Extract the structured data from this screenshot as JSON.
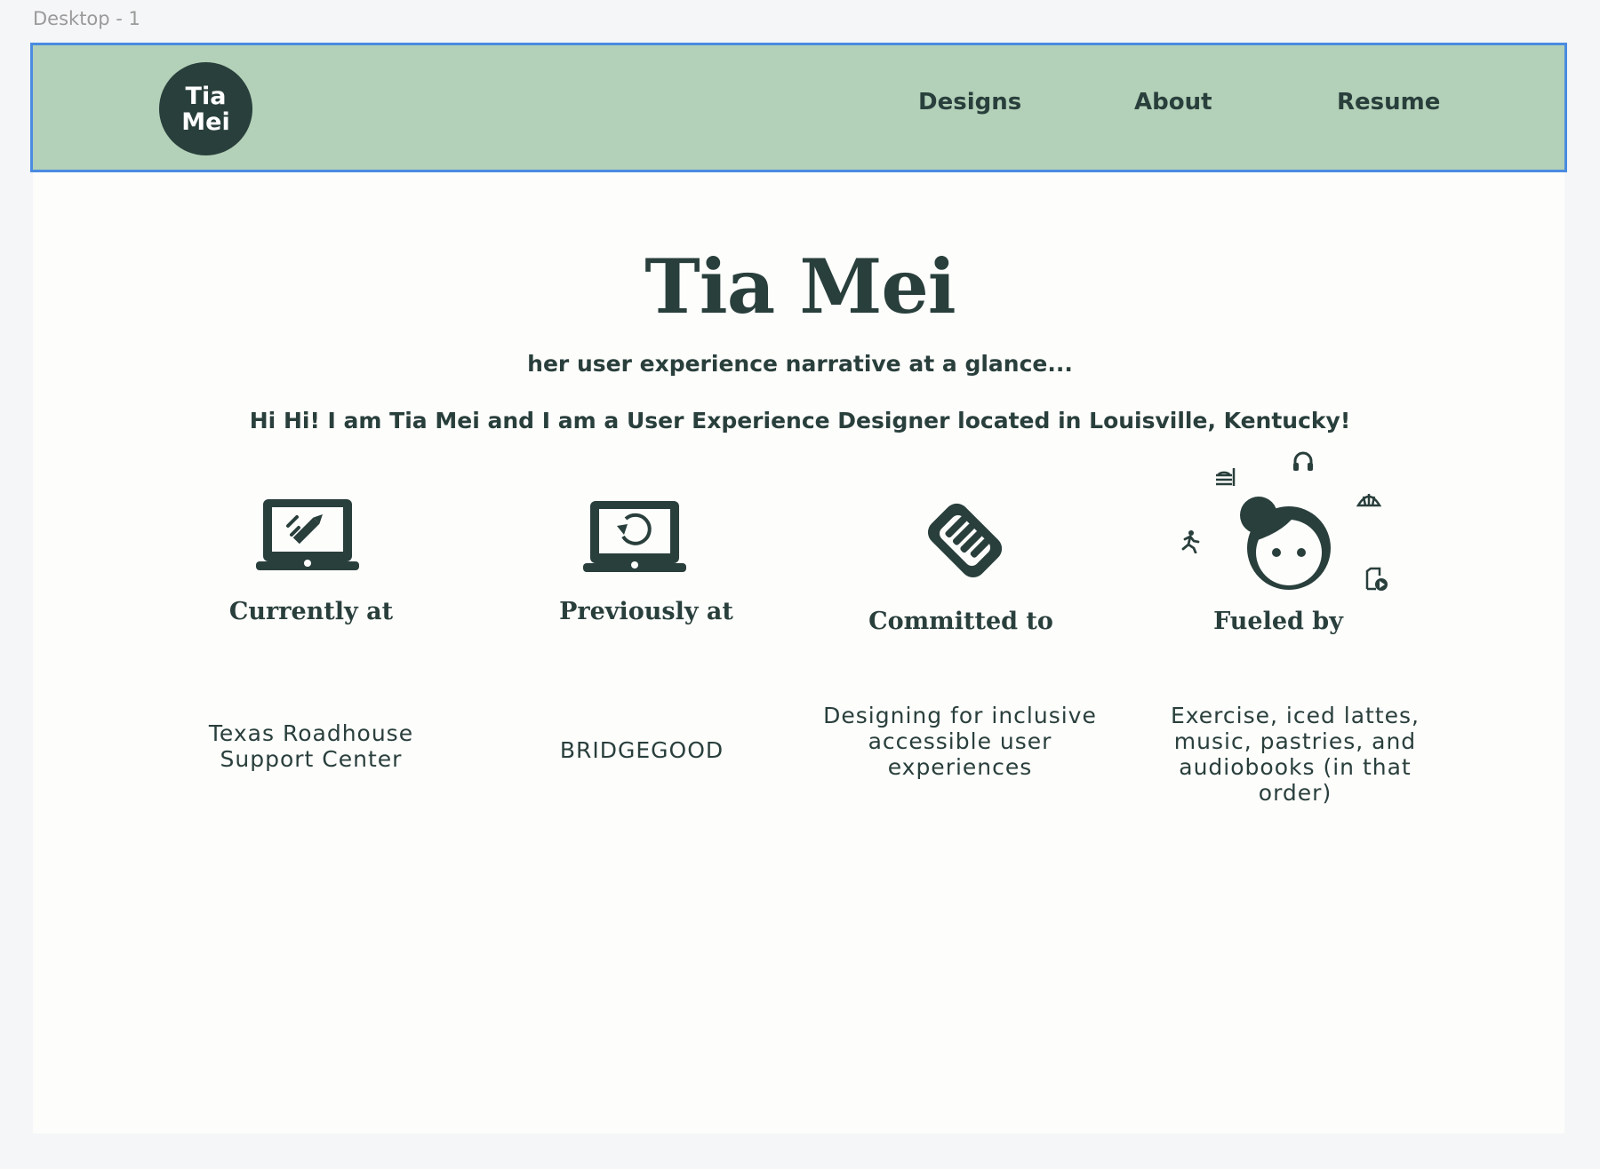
{
  "canvas": {
    "frame_label": "Desktop - 1"
  },
  "header": {
    "logo_line1": "Tia",
    "logo_line2": "Mei",
    "nav": [
      "Designs",
      "About",
      "Resume"
    ]
  },
  "hero": {
    "title": "Tia Mei",
    "tagline": "her user experience narrative at a glance...",
    "intro": "Hi Hi! I am Tia Mei and I am a User Experience Designer located in Louisville, Kentucky!"
  },
  "cards": [
    {
      "icon": "laptop-edit-icon",
      "title": "Currently at",
      "text": "Texas Roadhouse Support Center"
    },
    {
      "icon": "laptop-history-icon",
      "title": "Previously at",
      "text": "BRIDGEGOOD"
    },
    {
      "icon": "handshake-icon",
      "title": "Committed to",
      "text": "Designing for inclusive accessible user experiences"
    },
    {
      "icon": "face-icon",
      "title": "Fueled by",
      "text": "Exercise, iced lattes, music, pastries, and audiobooks (in that order)"
    }
  ],
  "colors": {
    "accent_dark": "#293f3c",
    "nav_bg": "#b3d0b8",
    "selection_border": "#4a8be0",
    "page_bg": "#fdfdfb"
  }
}
